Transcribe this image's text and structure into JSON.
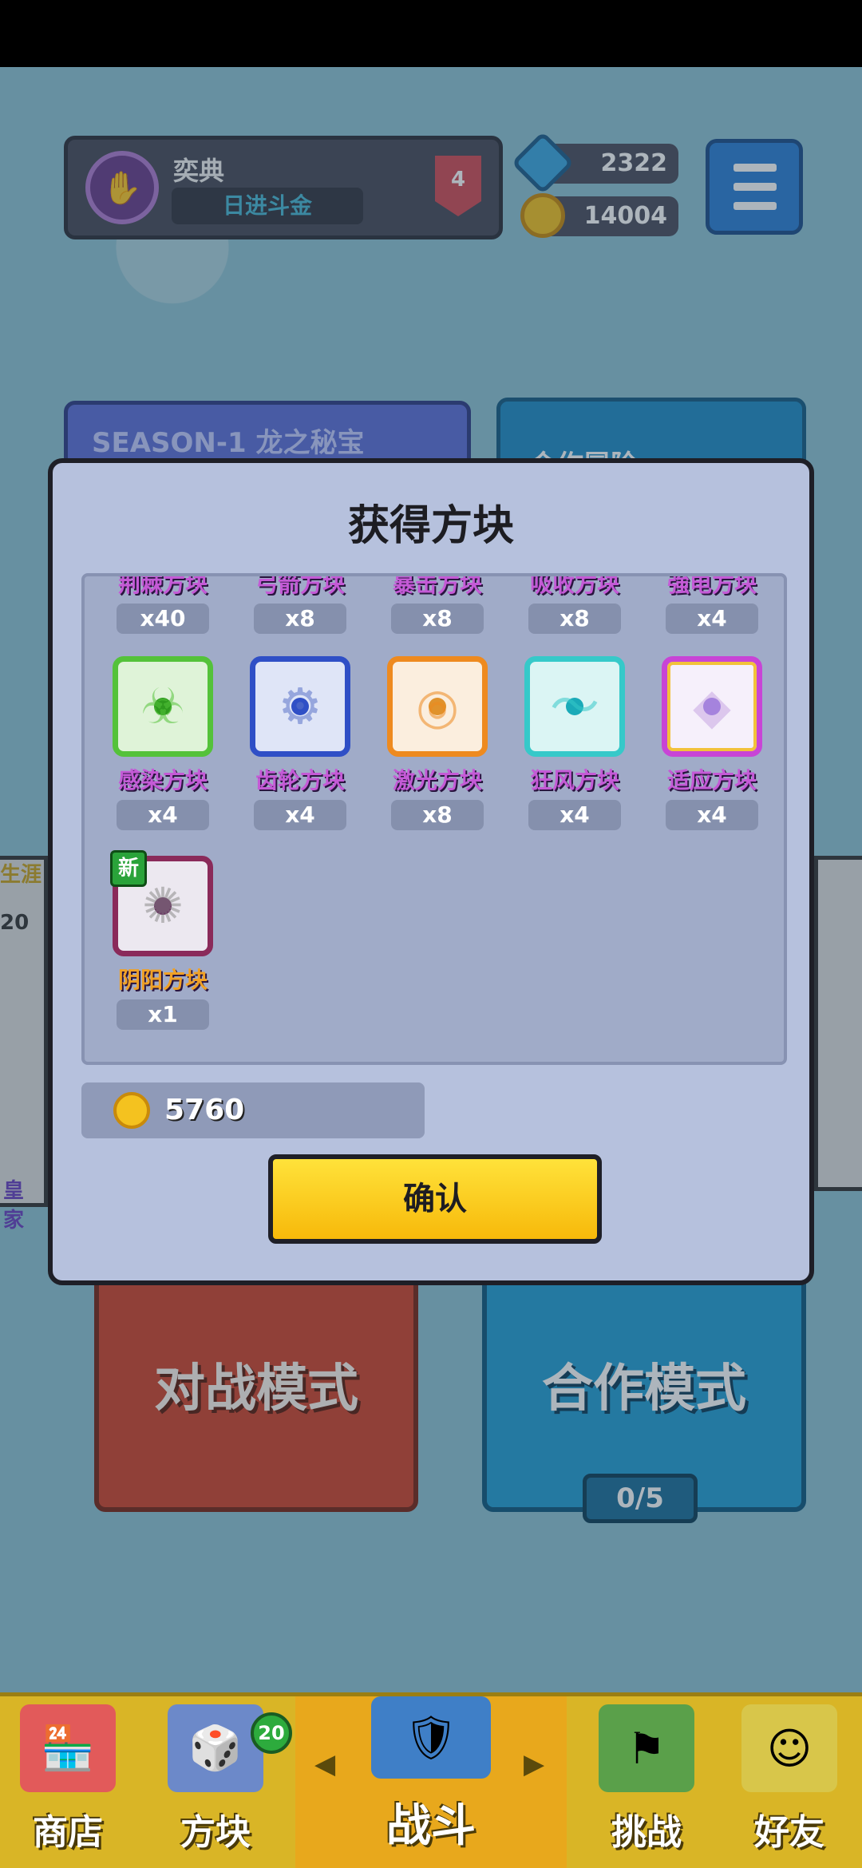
{
  "player": {
    "name": "奕典",
    "title": "日进斗金",
    "rank": "4"
  },
  "currency": {
    "gems": "2322",
    "coins": "14004"
  },
  "background": {
    "season_label": "SEASON-1 龙之秘宝",
    "coop_label": "合作冒险",
    "left_tag": "生涯",
    "left_num": "20",
    "left_bottom": "皇家",
    "battle_mode": "对战模式",
    "coop_mode": "合作模式",
    "coop_progress": "0/5"
  },
  "modal": {
    "title": "获得方块",
    "top_row_partial": [
      {
        "name": "荆棘方块",
        "count": "x40"
      },
      {
        "name": "弓箭方块",
        "count": "x8"
      },
      {
        "name": "暴击方块",
        "count": "x8"
      },
      {
        "name": "吸收方块",
        "count": "x8"
      },
      {
        "name": "強电方块",
        "count": "x4"
      }
    ],
    "row2": [
      {
        "name": "感染方块",
        "count": "x4",
        "color": "#54c23a",
        "glyph": "☣"
      },
      {
        "name": "齿轮方块",
        "count": "x4",
        "color": "#2f4fc6",
        "glyph": "⚙"
      },
      {
        "name": "激光方块",
        "count": "x8",
        "color": "#ee8a1f",
        "glyph": "◎"
      },
      {
        "name": "狂风方块",
        "count": "x4",
        "color": "#36c9c9",
        "glyph": "〜"
      },
      {
        "name": "适应方块",
        "count": "x4",
        "color": "#c844d6",
        "glyph": "◆"
      }
    ],
    "row3": [
      {
        "name": "阴阳方块",
        "count": "x1",
        "color": "#8a2a5a",
        "glyph": "✺",
        "new_tag": "新"
      }
    ],
    "coin_reward": "5760",
    "confirm_label": "确认"
  },
  "nav": {
    "shop": "商店",
    "dice": "方块",
    "dice_badge": "20",
    "battle": "战斗",
    "challenge": "挑战",
    "friends": "好友"
  }
}
